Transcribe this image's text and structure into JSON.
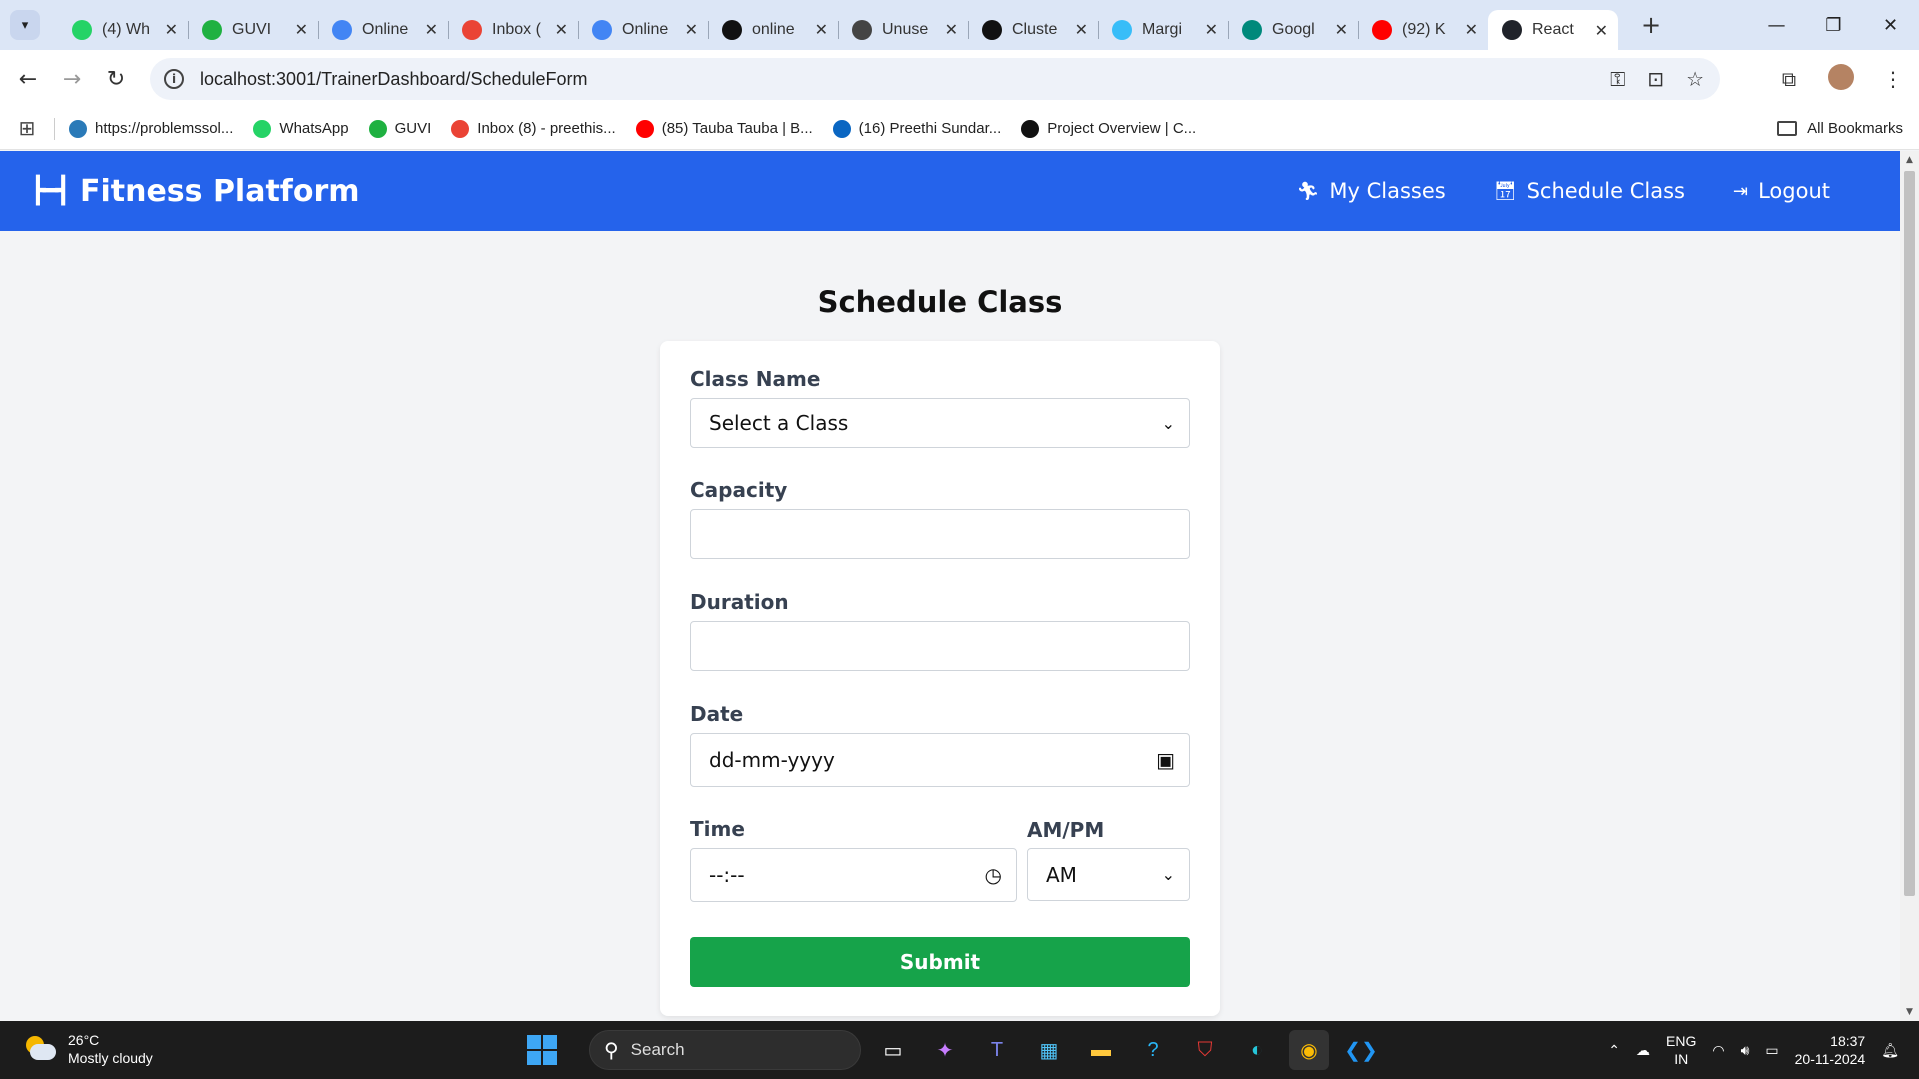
{
  "browser": {
    "tabs": [
      {
        "title": "(4) Wh",
        "icon": "whatsapp-icon",
        "color": "#25d366"
      },
      {
        "title": "GUVI",
        "icon": "guvi-icon",
        "color": "#1fb141"
      },
      {
        "title": "Online",
        "icon": "google-docs-icon",
        "color": "#4285f4"
      },
      {
        "title": "Inbox (",
        "icon": "gmail-icon",
        "color": "#ea4335"
      },
      {
        "title": "Online",
        "icon": "google-docs-icon",
        "color": "#4285f4"
      },
      {
        "title": "online",
        "icon": "github-icon",
        "color": "#111111"
      },
      {
        "title": "Unuse",
        "icon": "openai-icon",
        "color": "#444444"
      },
      {
        "title": "Cluste",
        "icon": "mongodb-icon",
        "color": "#111111"
      },
      {
        "title": "Margi",
        "icon": "tailwind-icon",
        "color": "#38bdf8"
      },
      {
        "title": "Googl",
        "icon": "google-meet-icon",
        "color": "#00897b"
      },
      {
        "title": "(92) K",
        "icon": "youtube-icon",
        "color": "#ff0000"
      },
      {
        "title": "React",
        "icon": "react-icon",
        "color": "#20232a",
        "active": true
      }
    ],
    "url": "localhost:3001/TrainerDashboard/ScheduleForm",
    "bookmarks": [
      {
        "label": "https://problemssol...",
        "icon": "cloud-icon",
        "color": "#2a7ab8"
      },
      {
        "label": "WhatsApp",
        "icon": "whatsapp-icon",
        "color": "#25d366"
      },
      {
        "label": "GUVI",
        "icon": "guvi-icon",
        "color": "#1fb141"
      },
      {
        "label": "Inbox (8) - preethis...",
        "icon": "gmail-icon",
        "color": "#ea4335"
      },
      {
        "label": "(85) Tauba Tauba | B...",
        "icon": "youtube-icon",
        "color": "#ff0000"
      },
      {
        "label": "(16) Preethi Sundar...",
        "icon": "linkedin-icon",
        "color": "#0a66c2"
      },
      {
        "label": "Project Overview | C...",
        "icon": "mongodb-icon",
        "color": "#111111"
      }
    ],
    "all_bookmarks": "All Bookmarks"
  },
  "app": {
    "brand": "Fitness Platform",
    "nav": [
      {
        "label": "My Classes",
        "icon": "running-person-icon"
      },
      {
        "label": "Schedule Class",
        "icon": "calendar-icon"
      },
      {
        "label": "Logout",
        "icon": "logout-icon"
      }
    ],
    "accent": "#2563eb",
    "submit_color": "#16a34a"
  },
  "form": {
    "title": "Schedule Class",
    "class_name_label": "Class Name",
    "class_name_value": "Select a Class",
    "capacity_label": "Capacity",
    "capacity_value": "",
    "duration_label": "Duration",
    "duration_value": "",
    "date_label": "Date",
    "date_placeholder": "dd-mm-yyyy",
    "time_label": "Time",
    "time_placeholder": "--:--",
    "ampm_label": "AM/PM",
    "ampm_value": "AM",
    "submit_label": "Submit"
  },
  "taskbar": {
    "temperature": "26°C",
    "weather": "Mostly cloudy",
    "search_label": "Search",
    "lang_1": "ENG",
    "lang_2": "IN",
    "time": "18:37",
    "date": "20-11-2024"
  }
}
